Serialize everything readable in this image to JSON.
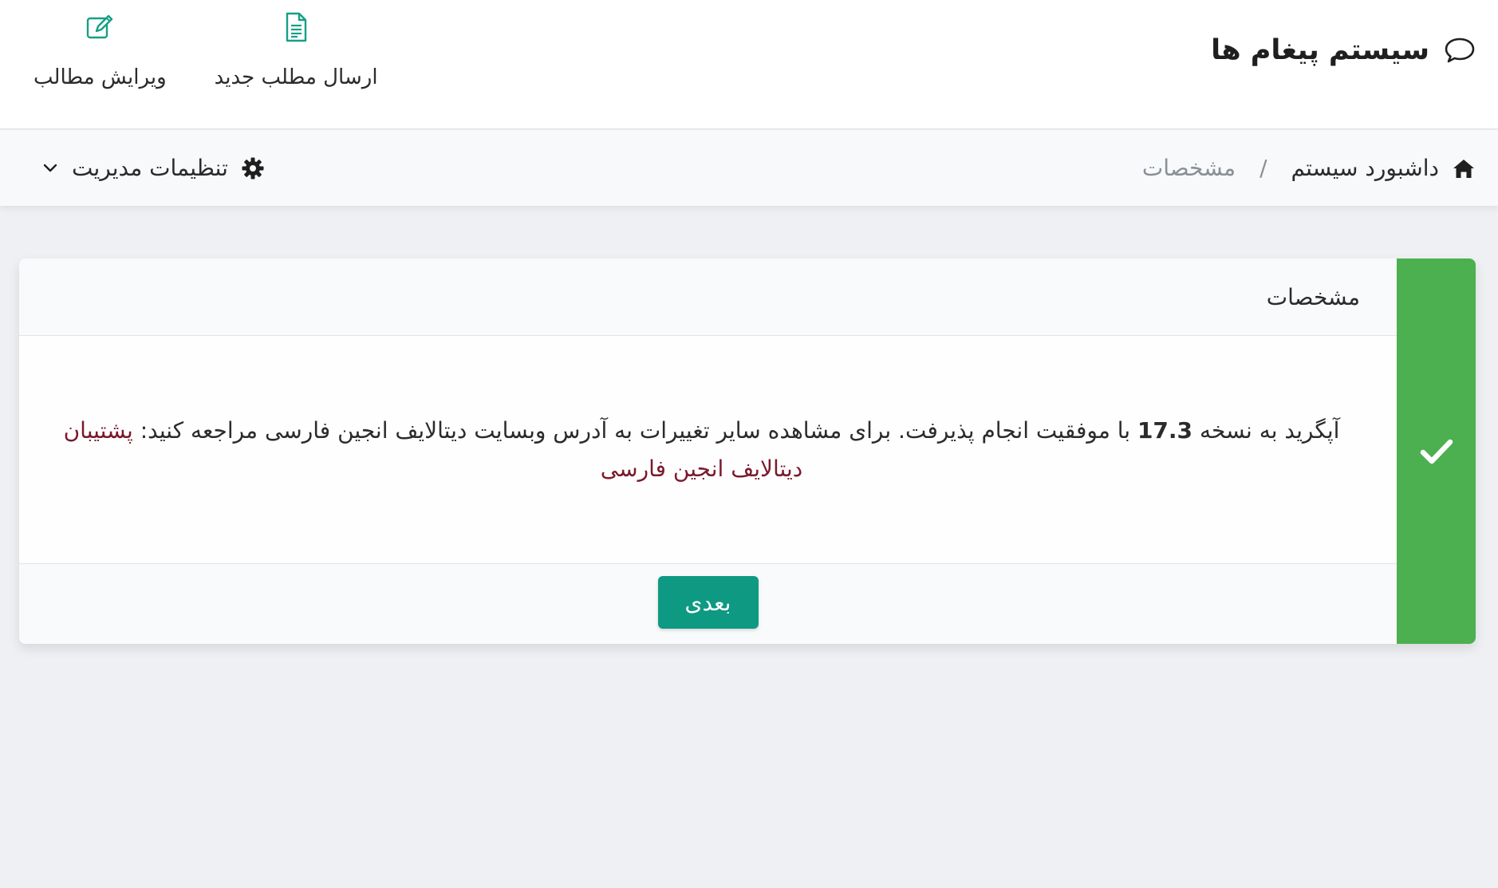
{
  "header": {
    "title": "سیستم پیغام ها",
    "actions": [
      {
        "label": "ارسال مطلب جدید",
        "icon": "file-text-icon"
      },
      {
        "label": "ویرایش مطالب",
        "icon": "edit-icon"
      }
    ]
  },
  "breadcrumb": {
    "home": "داشبورد سیستم",
    "separator": "/",
    "current": "مشخصات"
  },
  "settings": {
    "label": "تنظیمات مدیریت"
  },
  "card": {
    "title": "مشخصات",
    "message_before": "آپگرید به نسخه ",
    "version": "17.3",
    "message_after": " با موفقیت انجام پذیرفت. برای مشاهده سایر تغییرات به آدرس وبسایت دیتالایف انجین فارسی مراجعه کنید: ",
    "link_text": "پشتیبان دیتالایف انجین فارسی",
    "next_button": "بعدی",
    "status": "success"
  },
  "colors": {
    "accent": "#0e9a82",
    "success": "#4cb050",
    "link": "#7a1a2c",
    "icon_teal": "#16a085"
  }
}
